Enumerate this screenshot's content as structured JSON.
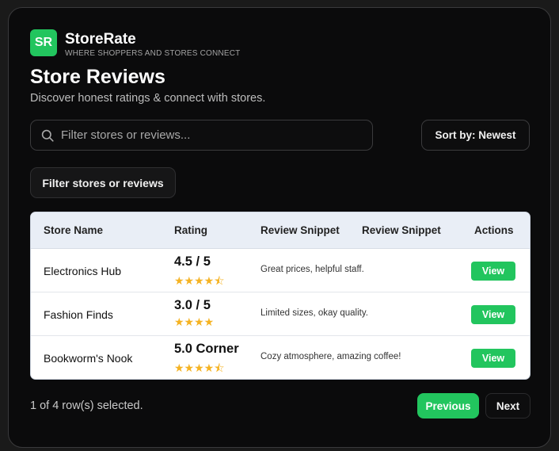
{
  "brand": {
    "logo_text": "SR",
    "name": "StoreRate",
    "tagline": "WHERE SHOPPERS AND STORES CONNECT"
  },
  "page": {
    "title": "Store Reviews",
    "subtitle": "Discover honest ratings & connect with stores."
  },
  "search": {
    "placeholder": "Filter stores or reviews...",
    "value": "",
    "icon": "search-icon"
  },
  "sort": {
    "label": "Sort by: Newest"
  },
  "filter_chip": {
    "label": "Filter stores or reviews"
  },
  "table": {
    "headers": [
      "Store Name",
      "Rating",
      "Review Snippet",
      "Review Snippet",
      "Actions"
    ],
    "rows": [
      {
        "store": "Electronics Hub",
        "rating": "4.5 / 5",
        "stars": "★★★★⯪",
        "stars_value": 4.5,
        "snippet": "Great prices, helpful staff.",
        "action": "View"
      },
      {
        "store": "Fashion Finds",
        "rating": "3.0 / 5",
        "stars": "★★★★",
        "stars_value": 4,
        "snippet": "Limited sizes, okay quality.",
        "action": "View"
      },
      {
        "store": "Bookworm's Nook",
        "rating": "5.0 Corner",
        "stars": "★★★★⯪",
        "stars_value": 4.5,
        "snippet": "Cozy atmosphere, amazing coffee!",
        "action": "View"
      }
    ]
  },
  "footer": {
    "selection": "1 of 4 row(s) selected.",
    "previous": "Previous",
    "next": "Next"
  },
  "colors": {
    "accent": "#22c55e",
    "star": "#f5b323",
    "background": "#0b0b0c",
    "table_header": "#e9eef6"
  }
}
